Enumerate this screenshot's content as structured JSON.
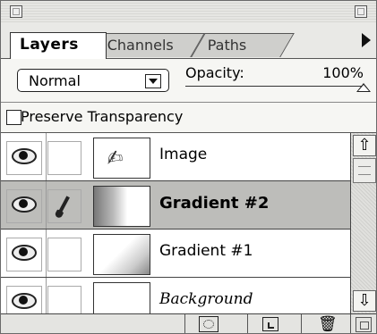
{
  "tabs": [
    {
      "label": "Layers",
      "active": true
    },
    {
      "label": "Channels",
      "active": false
    },
    {
      "label": "Paths",
      "active": false
    }
  ],
  "options": {
    "blend_mode": "Normal",
    "opacity_label": "Opacity:",
    "opacity_value": "100%",
    "preserve_label": "Preserve Transparency"
  },
  "layers": [
    {
      "name": "Image",
      "visible": true,
      "selected": false,
      "icon": "eye-icon"
    },
    {
      "name": "Gradient #2",
      "visible": true,
      "selected": true,
      "icon": "eye-icon"
    },
    {
      "name": "Gradient #1",
      "visible": true,
      "selected": false,
      "icon": "eye-icon"
    },
    {
      "name": "Background",
      "visible": true,
      "selected": false,
      "icon": "eye-icon"
    }
  ],
  "colors": {
    "selected_row": "#bdbdba",
    "panel_bg": "#f6f6f3"
  },
  "icons": [
    "eye-icon",
    "brush-icon",
    "palette-menu-icon",
    "add-mask-icon",
    "new-layer-icon",
    "trash-icon",
    "scroll-up-icon",
    "scroll-down-icon",
    "resize-icon"
  ]
}
